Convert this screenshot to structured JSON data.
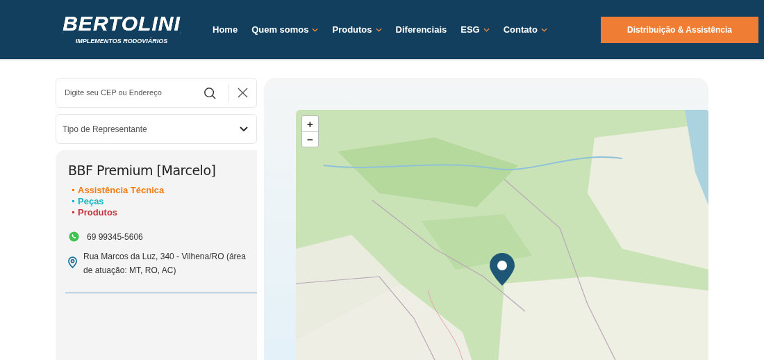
{
  "header": {
    "logo": {
      "name": "BERTOLINI",
      "tagline": "IMPLEMENTOS RODOVIÁRIOS"
    },
    "nav": [
      {
        "label": "Home",
        "dropdown": false
      },
      {
        "label": "Quem somos",
        "dropdown": true
      },
      {
        "label": "Produtos",
        "dropdown": true
      },
      {
        "label": "Diferenciais",
        "dropdown": false
      },
      {
        "label": "ESG",
        "dropdown": true
      },
      {
        "label": "Contato",
        "dropdown": true
      }
    ],
    "cta": "Distribuição & Assistência"
  },
  "search": {
    "placeholder": "Digite seu CEP ou Endereço"
  },
  "filter": {
    "placeholder": "Tipo de Representante"
  },
  "dealer": {
    "name": "BBF Premium [Marcelo]",
    "services": [
      {
        "label": "Assistência Técnica",
        "color": "#f07c12"
      },
      {
        "label": "Peças",
        "color": "#16b3c4"
      },
      {
        "label": "Produtos",
        "color": "#c8333f"
      }
    ],
    "phone": "69 99345-5606",
    "address": "Rua Marcos da Luz, 340 - Vilhena/RO (área de atuação: MT, RO, AC)"
  },
  "map": {
    "zoom_controls": [
      "+",
      "−"
    ],
    "kind": "picture"
  }
}
